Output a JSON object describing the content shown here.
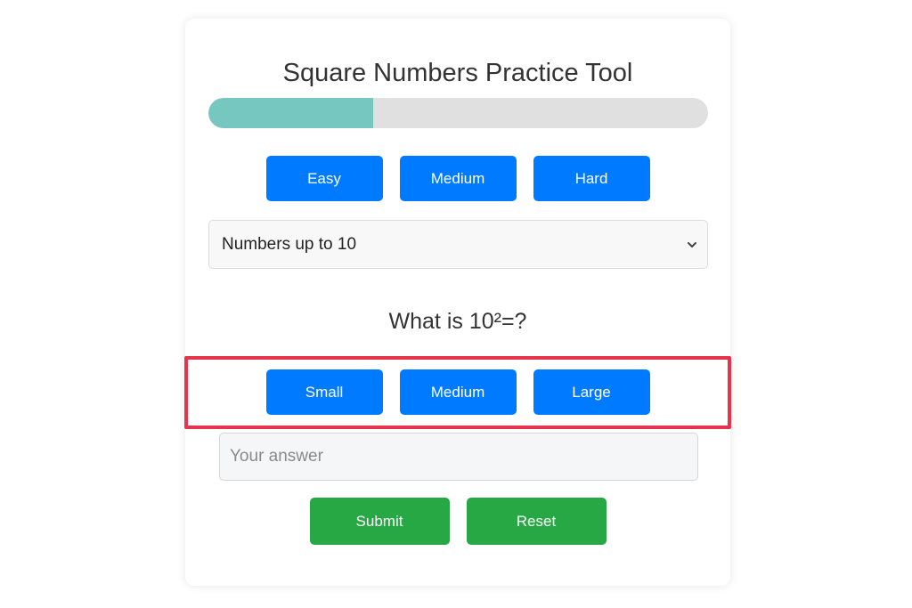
{
  "app": {
    "title": "Square Numbers Practice Tool"
  },
  "progress": {
    "fraction": 0.33,
    "fill_color": "#76c7c0",
    "track_color": "#e0e0e0"
  },
  "difficulty_buttons": [
    {
      "label": "Easy"
    },
    {
      "label": "Medium"
    },
    {
      "label": "Hard"
    }
  ],
  "range_select": {
    "selected": "Numbers up to 10",
    "icon": "chevron-down-icon"
  },
  "question": {
    "text": "What is 10²=?"
  },
  "size_buttons": [
    {
      "label": "Small"
    },
    {
      "label": "Medium"
    },
    {
      "label": "Large"
    }
  ],
  "answer": {
    "value": "",
    "placeholder": "Your answer"
  },
  "actions": {
    "submit_label": "Submit",
    "reset_label": "Reset"
  },
  "colors": {
    "primary_button": "#007bff",
    "success_button": "#28a745",
    "highlight_border": "#e8344a"
  }
}
